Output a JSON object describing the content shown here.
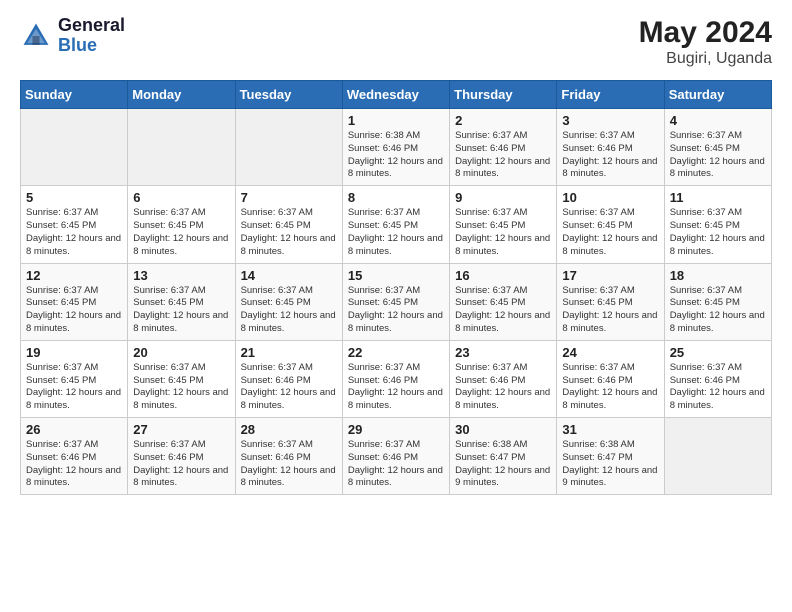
{
  "logo": {
    "general": "General",
    "blue": "Blue"
  },
  "header": {
    "month_year": "May 2024",
    "location": "Bugiri, Uganda"
  },
  "weekdays": [
    "Sunday",
    "Monday",
    "Tuesday",
    "Wednesday",
    "Thursday",
    "Friday",
    "Saturday"
  ],
  "weeks": [
    [
      {
        "day": "",
        "sunrise": "",
        "sunset": "",
        "daylight": ""
      },
      {
        "day": "",
        "sunrise": "",
        "sunset": "",
        "daylight": ""
      },
      {
        "day": "",
        "sunrise": "",
        "sunset": "",
        "daylight": ""
      },
      {
        "day": "1",
        "sunrise": "Sunrise: 6:38 AM",
        "sunset": "Sunset: 6:46 PM",
        "daylight": "Daylight: 12 hours and 8 minutes."
      },
      {
        "day": "2",
        "sunrise": "Sunrise: 6:37 AM",
        "sunset": "Sunset: 6:46 PM",
        "daylight": "Daylight: 12 hours and 8 minutes."
      },
      {
        "day": "3",
        "sunrise": "Sunrise: 6:37 AM",
        "sunset": "Sunset: 6:46 PM",
        "daylight": "Daylight: 12 hours and 8 minutes."
      },
      {
        "day": "4",
        "sunrise": "Sunrise: 6:37 AM",
        "sunset": "Sunset: 6:45 PM",
        "daylight": "Daylight: 12 hours and 8 minutes."
      }
    ],
    [
      {
        "day": "5",
        "sunrise": "Sunrise: 6:37 AM",
        "sunset": "Sunset: 6:45 PM",
        "daylight": "Daylight: 12 hours and 8 minutes."
      },
      {
        "day": "6",
        "sunrise": "Sunrise: 6:37 AM",
        "sunset": "Sunset: 6:45 PM",
        "daylight": "Daylight: 12 hours and 8 minutes."
      },
      {
        "day": "7",
        "sunrise": "Sunrise: 6:37 AM",
        "sunset": "Sunset: 6:45 PM",
        "daylight": "Daylight: 12 hours and 8 minutes."
      },
      {
        "day": "8",
        "sunrise": "Sunrise: 6:37 AM",
        "sunset": "Sunset: 6:45 PM",
        "daylight": "Daylight: 12 hours and 8 minutes."
      },
      {
        "day": "9",
        "sunrise": "Sunrise: 6:37 AM",
        "sunset": "Sunset: 6:45 PM",
        "daylight": "Daylight: 12 hours and 8 minutes."
      },
      {
        "day": "10",
        "sunrise": "Sunrise: 6:37 AM",
        "sunset": "Sunset: 6:45 PM",
        "daylight": "Daylight: 12 hours and 8 minutes."
      },
      {
        "day": "11",
        "sunrise": "Sunrise: 6:37 AM",
        "sunset": "Sunset: 6:45 PM",
        "daylight": "Daylight: 12 hours and 8 minutes."
      }
    ],
    [
      {
        "day": "12",
        "sunrise": "Sunrise: 6:37 AM",
        "sunset": "Sunset: 6:45 PM",
        "daylight": "Daylight: 12 hours and 8 minutes."
      },
      {
        "day": "13",
        "sunrise": "Sunrise: 6:37 AM",
        "sunset": "Sunset: 6:45 PM",
        "daylight": "Daylight: 12 hours and 8 minutes."
      },
      {
        "day": "14",
        "sunrise": "Sunrise: 6:37 AM",
        "sunset": "Sunset: 6:45 PM",
        "daylight": "Daylight: 12 hours and 8 minutes."
      },
      {
        "day": "15",
        "sunrise": "Sunrise: 6:37 AM",
        "sunset": "Sunset: 6:45 PM",
        "daylight": "Daylight: 12 hours and 8 minutes."
      },
      {
        "day": "16",
        "sunrise": "Sunrise: 6:37 AM",
        "sunset": "Sunset: 6:45 PM",
        "daylight": "Daylight: 12 hours and 8 minutes."
      },
      {
        "day": "17",
        "sunrise": "Sunrise: 6:37 AM",
        "sunset": "Sunset: 6:45 PM",
        "daylight": "Daylight: 12 hours and 8 minutes."
      },
      {
        "day": "18",
        "sunrise": "Sunrise: 6:37 AM",
        "sunset": "Sunset: 6:45 PM",
        "daylight": "Daylight: 12 hours and 8 minutes."
      }
    ],
    [
      {
        "day": "19",
        "sunrise": "Sunrise: 6:37 AM",
        "sunset": "Sunset: 6:45 PM",
        "daylight": "Daylight: 12 hours and 8 minutes."
      },
      {
        "day": "20",
        "sunrise": "Sunrise: 6:37 AM",
        "sunset": "Sunset: 6:45 PM",
        "daylight": "Daylight: 12 hours and 8 minutes."
      },
      {
        "day": "21",
        "sunrise": "Sunrise: 6:37 AM",
        "sunset": "Sunset: 6:46 PM",
        "daylight": "Daylight: 12 hours and 8 minutes."
      },
      {
        "day": "22",
        "sunrise": "Sunrise: 6:37 AM",
        "sunset": "Sunset: 6:46 PM",
        "daylight": "Daylight: 12 hours and 8 minutes."
      },
      {
        "day": "23",
        "sunrise": "Sunrise: 6:37 AM",
        "sunset": "Sunset: 6:46 PM",
        "daylight": "Daylight: 12 hours and 8 minutes."
      },
      {
        "day": "24",
        "sunrise": "Sunrise: 6:37 AM",
        "sunset": "Sunset: 6:46 PM",
        "daylight": "Daylight: 12 hours and 8 minutes."
      },
      {
        "day": "25",
        "sunrise": "Sunrise: 6:37 AM",
        "sunset": "Sunset: 6:46 PM",
        "daylight": "Daylight: 12 hours and 8 minutes."
      }
    ],
    [
      {
        "day": "26",
        "sunrise": "Sunrise: 6:37 AM",
        "sunset": "Sunset: 6:46 PM",
        "daylight": "Daylight: 12 hours and 8 minutes."
      },
      {
        "day": "27",
        "sunrise": "Sunrise: 6:37 AM",
        "sunset": "Sunset: 6:46 PM",
        "daylight": "Daylight: 12 hours and 8 minutes."
      },
      {
        "day": "28",
        "sunrise": "Sunrise: 6:37 AM",
        "sunset": "Sunset: 6:46 PM",
        "daylight": "Daylight: 12 hours and 8 minutes."
      },
      {
        "day": "29",
        "sunrise": "Sunrise: 6:37 AM",
        "sunset": "Sunset: 6:46 PM",
        "daylight": "Daylight: 12 hours and 8 minutes."
      },
      {
        "day": "30",
        "sunrise": "Sunrise: 6:38 AM",
        "sunset": "Sunset: 6:47 PM",
        "daylight": "Daylight: 12 hours and 9 minutes."
      },
      {
        "day": "31",
        "sunrise": "Sunrise: 6:38 AM",
        "sunset": "Sunset: 6:47 PM",
        "daylight": "Daylight: 12 hours and 9 minutes."
      },
      {
        "day": "",
        "sunrise": "",
        "sunset": "",
        "daylight": ""
      }
    ]
  ]
}
